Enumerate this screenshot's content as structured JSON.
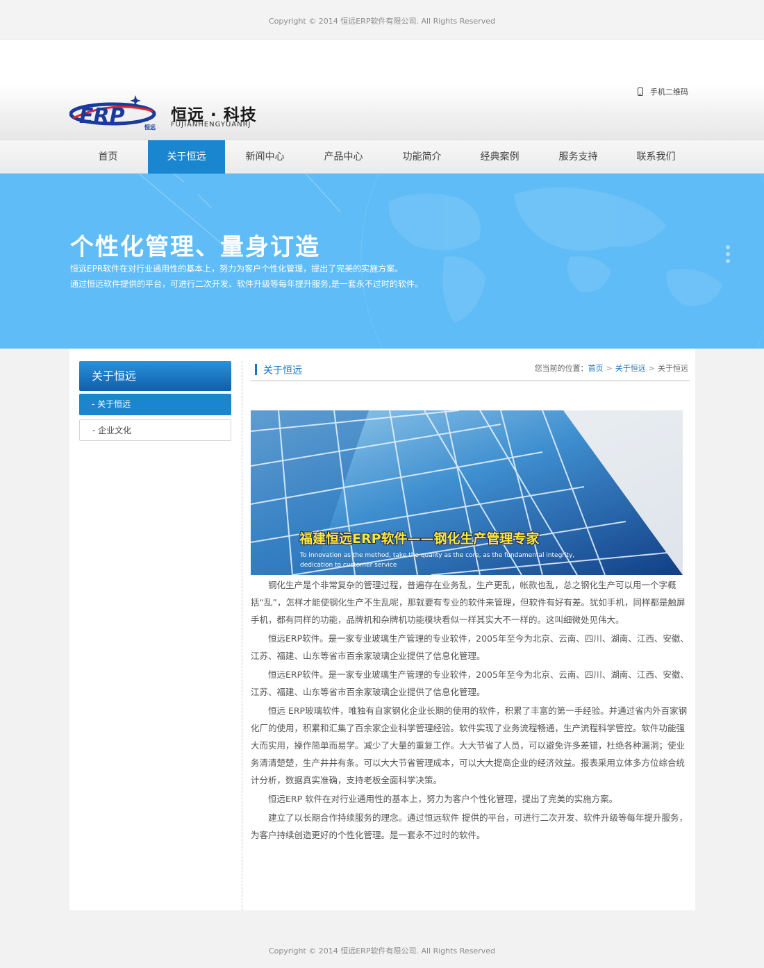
{
  "top_copyright": "Copyright © 2014 恒远ERP软件有限公司. All Rights Reserved",
  "header": {
    "brand_cn": "恒远 · 科技",
    "brand_en": "FUJIANHENGYUANRJ",
    "logo_text": "ERP",
    "logo_sub": "恒远",
    "qr_label": "手机二维码"
  },
  "nav": {
    "items": [
      {
        "label": "首页"
      },
      {
        "label": "关于恒远"
      },
      {
        "label": "新闻中心"
      },
      {
        "label": "产品中心"
      },
      {
        "label": "功能简介"
      },
      {
        "label": "经典案例"
      },
      {
        "label": "服务支持"
      },
      {
        "label": "联系我们"
      }
    ],
    "active_index": 1
  },
  "banner": {
    "headline": "个性化管理、量身订造",
    "line1": "恒远EPR软件在对行业通用性的基本上，努力为客户个性化管理，提出了完美的实施方案。",
    "line2": "通过恒远软件提供的平台，可进行二次开发、软件升级等每年提升服务,是一套永不过时的软件。"
  },
  "sidebar": {
    "title": "关于恒远",
    "items": [
      {
        "label": "- 关于恒远",
        "active": true
      },
      {
        "label": "- 企业文化",
        "active": false
      }
    ]
  },
  "section": {
    "title": "关于恒远",
    "breadcrumb": {
      "prefix": "您当前的位置：",
      "home": "首页",
      "level1": "关于恒远",
      "current": "关于恒远",
      "separator": ">"
    }
  },
  "hero": {
    "tagline": "福建恒远ERP软件——钢化生产管理专家",
    "en_line1": "To innovation as the method, take the quality as the core, as the fundamental integrity,",
    "en_line2": "dedication to customer service"
  },
  "article": {
    "paragraphs": [
      "钢化生产是个非常复杂的管理过程，普遍存在业务乱，生产更乱，帐款也乱，总之钢化生产可以用一个字概括“乱”，怎样才能使钢化生产不生乱呢，那就要有专业的软件来管理，但软件有好有差。犹如手机，同样都是触屏手机，都有同样的功能，品牌机和杂牌机功能模块看似一样其实大不一样的。这叫细微处见伟大。",
      "恒远ERP软件。是一家专业玻璃生产管理的专业软件，2005年至今为北京、云南、四川、湖南、江西、安徽、江苏、福建、山东等省市百余家玻璃企业提供了信息化管理。",
      "恒远ERP软件。是一家专业玻璃生产管理的专业软件，2005年至今为北京、云南、四川、湖南、江西、安徽、江苏、福建、山东等省市百余家玻璃企业提供了信息化管理。",
      "恒远 ERP玻璃软件，唯独有自家钢化企业长期的使用的软件，积累了丰富的第一手经验。并通过省内外百家钢化厂的使用，积累和汇集了百余家企业科学管理经验。软件实现了业务流程畅通，生产流程科学管控。软件功能强大而实用，操作简单而易学。减少了大量的重复工作。大大节省了人员，可以避免许多差错，杜绝各种漏洞；使业务清清楚楚，生产井井有条。可以大大节省管理成本，可以大大提高企业的经济效益。报表采用立体多方位综合统计分析，数据真实准确，支持老板全面科学决策。",
      "恒远ERP 软件在对行业通用性的基本上，努力为客户个性化管理，提出了完美的实施方案。",
      "建立了以长期合作持续服务的理念。通过恒远软件 提供的平台，可进行二次开发、软件升级等每年提升服务，为客户持续创造更好的个性化管理。是一套永不过时的软件。"
    ]
  },
  "footer_copyright": "Copyright © 2014 恒远ERP软件有限公司. All Rights Reserved",
  "colors": {
    "accent": "#1a86d0",
    "banner": "#5fbcf6",
    "logo_blue": "#1a3a9c",
    "logo_red": "#e32626"
  }
}
